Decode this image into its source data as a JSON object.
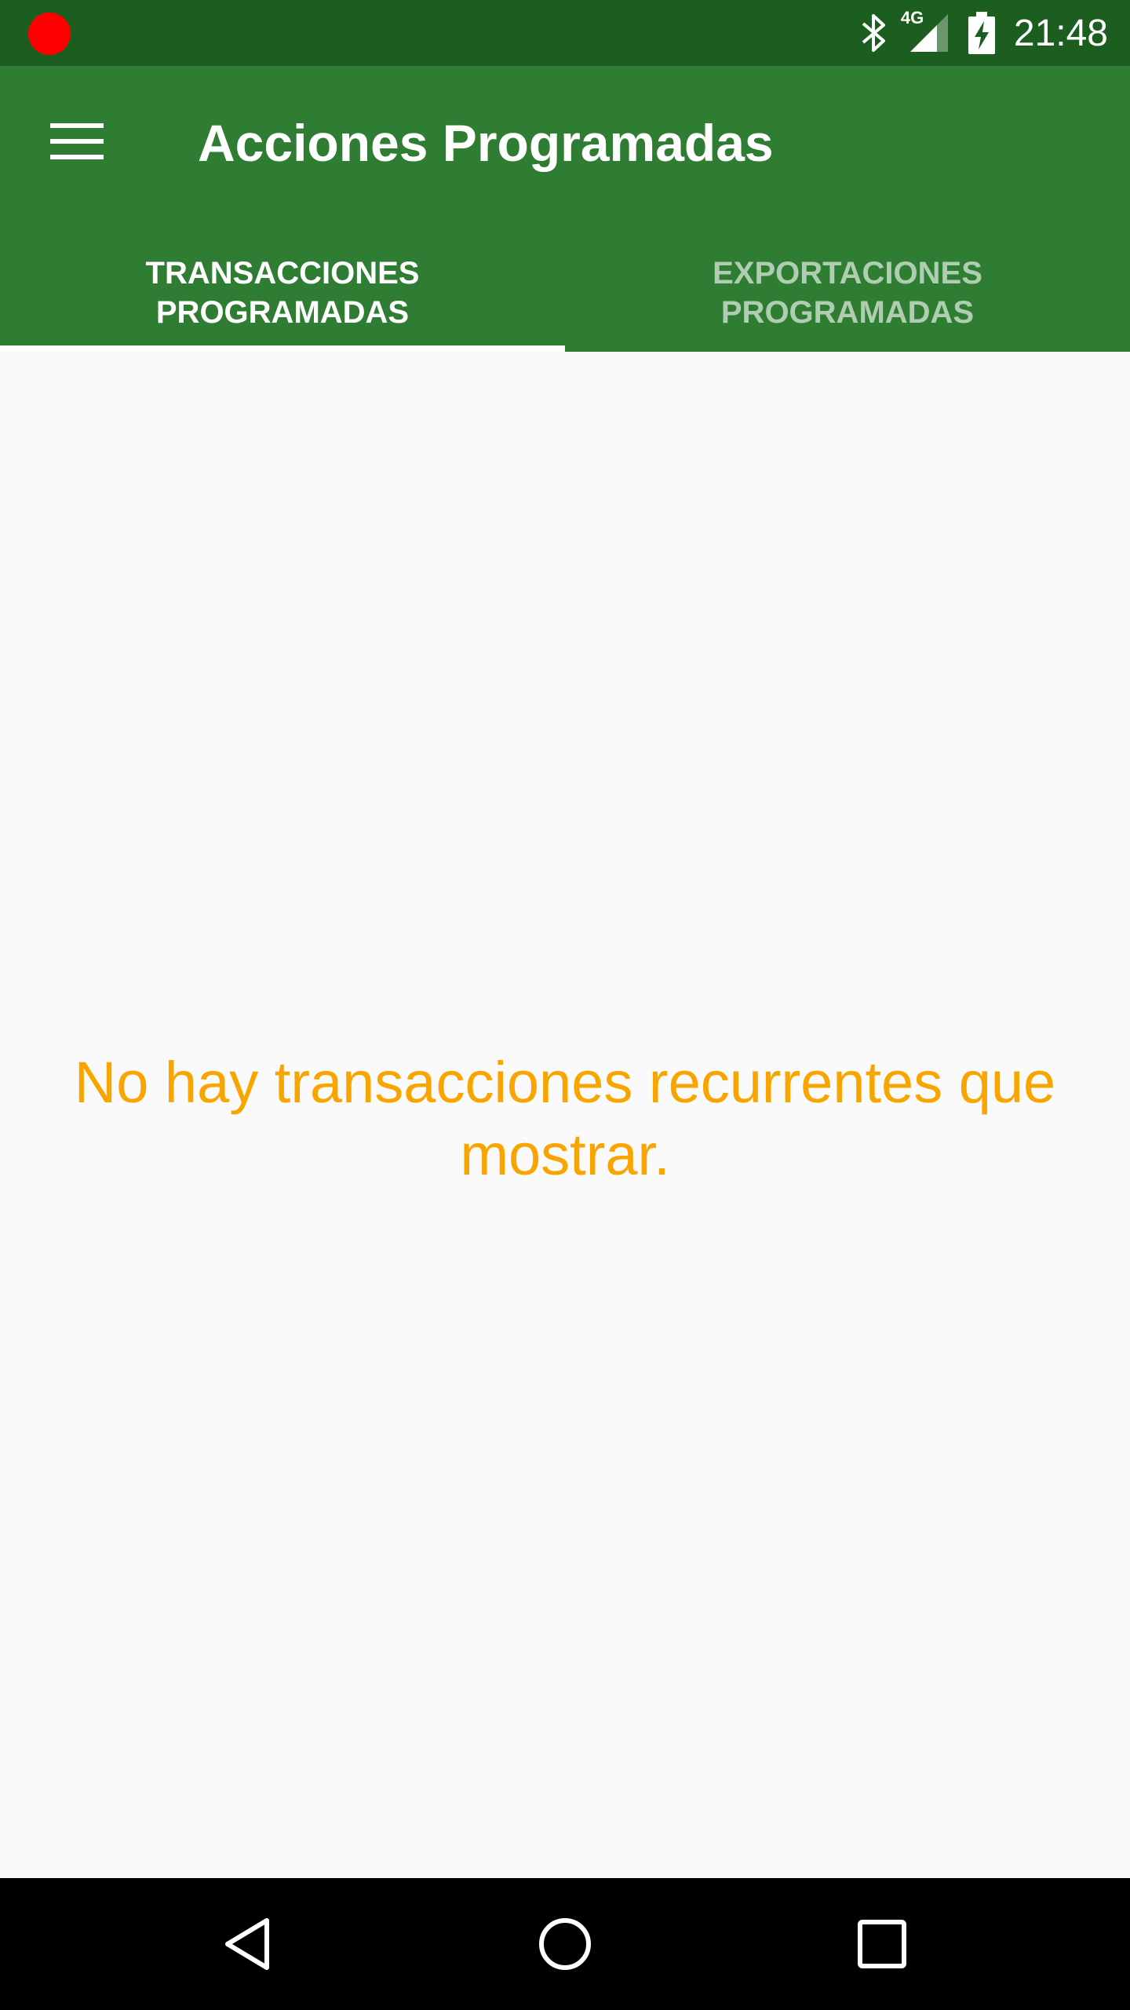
{
  "status_bar": {
    "time": "21:48",
    "network_label": "4G",
    "icons": [
      "record-icon",
      "bluetooth-icon",
      "signal-icon",
      "battery-charging-icon"
    ]
  },
  "app_bar": {
    "title": "Acciones Programadas",
    "menu_icon": "hamburger-menu-icon"
  },
  "tabs": [
    {
      "line1": "TRANSACCIONES",
      "line2": "PROGRAMADAS",
      "selected": true
    },
    {
      "line1": "EXPORTACIONES",
      "line2": "PROGRAMADAS",
      "selected": false
    }
  ],
  "main": {
    "empty_message": "No hay transacciones recurrentes que mostrar."
  },
  "nav_bar": {
    "buttons": [
      "back-icon",
      "home-icon",
      "recents-icon"
    ]
  },
  "colors": {
    "status_bar": "#1b5e20",
    "app_bar": "#2e7d32",
    "empty_text": "#f9a500",
    "background": "#fafafa",
    "record_dot": "#ff0000"
  }
}
